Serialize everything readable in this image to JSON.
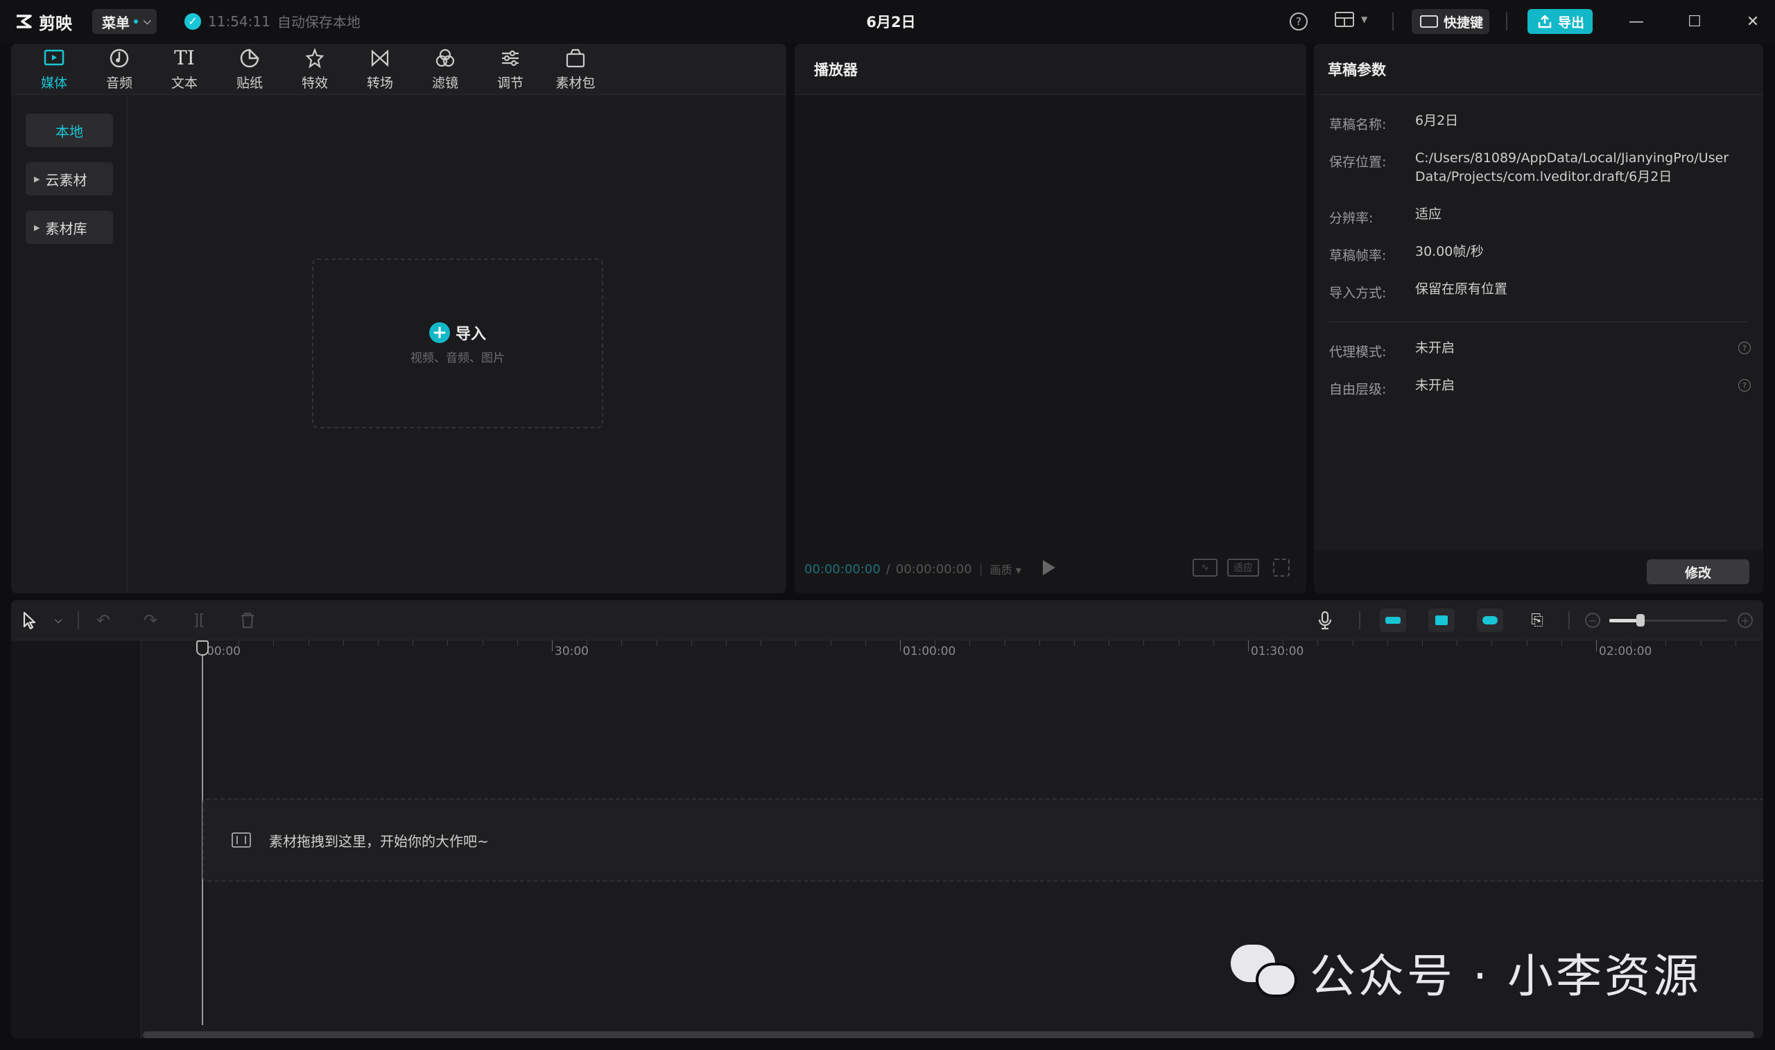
{
  "titlebar": {
    "app_name": "剪映",
    "menu_label": "菜单",
    "save_time": "11:54:11",
    "save_status": "自动保存本地",
    "project_title": "6月2日",
    "shortcut_label": "快捷键",
    "export_label": "导出"
  },
  "media_tabs": [
    {
      "label": "媒体",
      "icon": "media-icon"
    },
    {
      "label": "音频",
      "icon": "audio-icon"
    },
    {
      "label": "文本",
      "icon": "text-icon"
    },
    {
      "label": "贴纸",
      "icon": "sticker-icon"
    },
    {
      "label": "特效",
      "icon": "effects-icon"
    },
    {
      "label": "转场",
      "icon": "transition-icon"
    },
    {
      "label": "滤镜",
      "icon": "filter-icon"
    },
    {
      "label": "调节",
      "icon": "adjust-icon"
    },
    {
      "label": "素材包",
      "icon": "package-icon"
    }
  ],
  "media_sidebar": [
    {
      "label": "本地"
    },
    {
      "label": "云素材"
    },
    {
      "label": "素材库"
    }
  ],
  "import": {
    "label": "导入",
    "hint": "视频、音频、图片"
  },
  "player": {
    "title": "播放器",
    "current_time": "00:00:00:00",
    "total_time": "00:00:00:00",
    "quality": "画质",
    "fit_label": "适应"
  },
  "params": {
    "title": "草稿参数",
    "rows": [
      {
        "label": "草稿名称:",
        "value": "6月2日"
      },
      {
        "label": "保存位置:",
        "value": "C:/Users/81089/AppData/Local/JianyingPro/User Data/Projects/com.lveditor.draft/6月2日"
      },
      {
        "label": "分辨率:",
        "value": "适应"
      },
      {
        "label": "草稿帧率:",
        "value": "30.00帧/秒"
      },
      {
        "label": "导入方式:",
        "value": "保留在原有位置"
      },
      {
        "label": "代理模式:",
        "value": "未开启"
      },
      {
        "label": "自由层级:",
        "value": "未开启"
      }
    ],
    "modify_label": "修改"
  },
  "timeline": {
    "ruler_labels": [
      "00:00",
      "30:00",
      "01:00:00",
      "01:30:00",
      "02:00:00"
    ],
    "drop_hint": "素材拖拽到这里，开始你的大作吧~"
  },
  "watermark": {
    "text": "公众号 · 小李资源"
  },
  "colors": {
    "accent": "#19c6d6",
    "export_bg": "#12b8c8",
    "background": "#0e0e10",
    "panel": "#1b1b1d"
  }
}
